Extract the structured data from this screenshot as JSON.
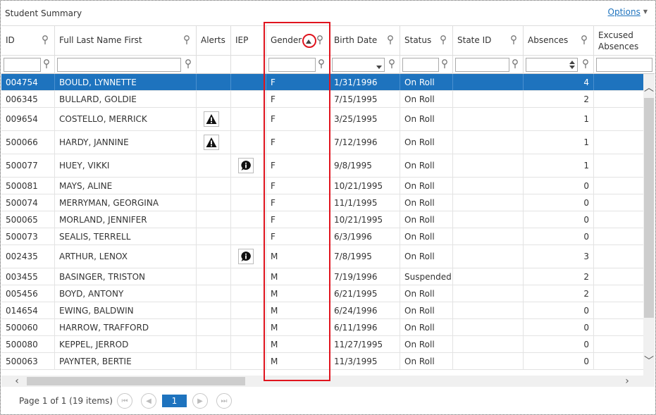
{
  "panel": {
    "title": "Student Summary",
    "options_label": "Options"
  },
  "columns": [
    {
      "key": "id",
      "label": "ID"
    },
    {
      "key": "name",
      "label": "Full Last Name First"
    },
    {
      "key": "alerts",
      "label": "Alerts"
    },
    {
      "key": "iep",
      "label": "IEP"
    },
    {
      "key": "gender",
      "label": "Gender"
    },
    {
      "key": "birth",
      "label": "Birth Date"
    },
    {
      "key": "status",
      "label": "Status"
    },
    {
      "key": "stateid",
      "label": "State ID"
    },
    {
      "key": "absences",
      "label": "Absences"
    },
    {
      "key": "excused",
      "label": "Excused Absences"
    }
  ],
  "rows": [
    {
      "id": "004754",
      "name": "BOULD, LYNNETTE",
      "alert": false,
      "iep": false,
      "gender": "F",
      "birth": "1/31/1996",
      "status": "On Roll",
      "stateid": "",
      "absences": "4",
      "selected": true
    },
    {
      "id": "006345",
      "name": "BULLARD, GOLDIE",
      "alert": false,
      "iep": false,
      "gender": "F",
      "birth": "7/15/1995",
      "status": "On Roll",
      "stateid": "",
      "absences": "2"
    },
    {
      "id": "009654",
      "name": "COSTELLO, MERRICK",
      "alert": true,
      "iep": false,
      "gender": "F",
      "birth": "3/25/1995",
      "status": "On Roll",
      "stateid": "",
      "absences": "1"
    },
    {
      "id": "500066",
      "name": "HARDY, JANNINE",
      "alert": true,
      "iep": false,
      "gender": "F",
      "birth": "7/12/1996",
      "status": "On Roll",
      "stateid": "",
      "absences": "1"
    },
    {
      "id": "500077",
      "name": "HUEY, VIKKI",
      "alert": false,
      "iep": true,
      "gender": "F",
      "birth": "9/8/1995",
      "status": "On Roll",
      "stateid": "",
      "absences": "1"
    },
    {
      "id": "500081",
      "name": "MAYS, ALINE",
      "alert": false,
      "iep": false,
      "gender": "F",
      "birth": "10/21/1995",
      "status": "On Roll",
      "stateid": "",
      "absences": "0"
    },
    {
      "id": "500074",
      "name": "MERRYMAN, GEORGINA",
      "alert": false,
      "iep": false,
      "gender": "F",
      "birth": "11/1/1995",
      "status": "On Roll",
      "stateid": "",
      "absences": "0"
    },
    {
      "id": "500065",
      "name": "MORLAND, JENNIFER",
      "alert": false,
      "iep": false,
      "gender": "F",
      "birth": "10/21/1995",
      "status": "On Roll",
      "stateid": "",
      "absences": "0"
    },
    {
      "id": "500073",
      "name": "SEALIS, TERRELL",
      "alert": false,
      "iep": false,
      "gender": "F",
      "birth": "6/3/1996",
      "status": "On Roll",
      "stateid": "",
      "absences": "0"
    },
    {
      "id": "002435",
      "name": "ARTHUR, LENOX",
      "alert": false,
      "iep": true,
      "gender": "M",
      "birth": "7/8/1995",
      "status": "On Roll",
      "stateid": "",
      "absences": "3"
    },
    {
      "id": "003455",
      "name": "BASINGER, TRISTON",
      "alert": false,
      "iep": false,
      "gender": "M",
      "birth": "7/19/1996",
      "status": "Suspended",
      "stateid": "",
      "absences": "2"
    },
    {
      "id": "005456",
      "name": "BOYD, ANTONY",
      "alert": false,
      "iep": false,
      "gender": "M",
      "birth": "6/21/1995",
      "status": "On Roll",
      "stateid": "",
      "absences": "2"
    },
    {
      "id": "014654",
      "name": "EWING, BALDWIN",
      "alert": false,
      "iep": false,
      "gender": "M",
      "birth": "6/24/1996",
      "status": "On Roll",
      "stateid": "",
      "absences": "0"
    },
    {
      "id": "500060",
      "name": "HARROW, TRAFFORD",
      "alert": false,
      "iep": false,
      "gender": "M",
      "birth": "6/11/1996",
      "status": "On Roll",
      "stateid": "",
      "absences": "0"
    },
    {
      "id": "500080",
      "name": "KEPPEL, JERROD",
      "alert": false,
      "iep": false,
      "gender": "M",
      "birth": "11/27/1995",
      "status": "On Roll",
      "stateid": "",
      "absences": "0"
    },
    {
      "id": "500063",
      "name": "PAYNTER, BERTIE",
      "alert": false,
      "iep": false,
      "gender": "M",
      "birth": "11/3/1995",
      "status": "On Roll",
      "stateid": "",
      "absences": "0"
    }
  ],
  "pager": {
    "info": "Page 1 of 1 (19 items)",
    "current_page": "1"
  },
  "colors": {
    "selected_row": "#1e73be",
    "highlight": "#e0141e",
    "link": "#1e73be"
  },
  "icons": [
    "pin-filter-icon",
    "sort-ascending-icon",
    "warning-icon",
    "info-icon",
    "dropdown-caret-icon",
    "spin-updown-icon"
  ]
}
